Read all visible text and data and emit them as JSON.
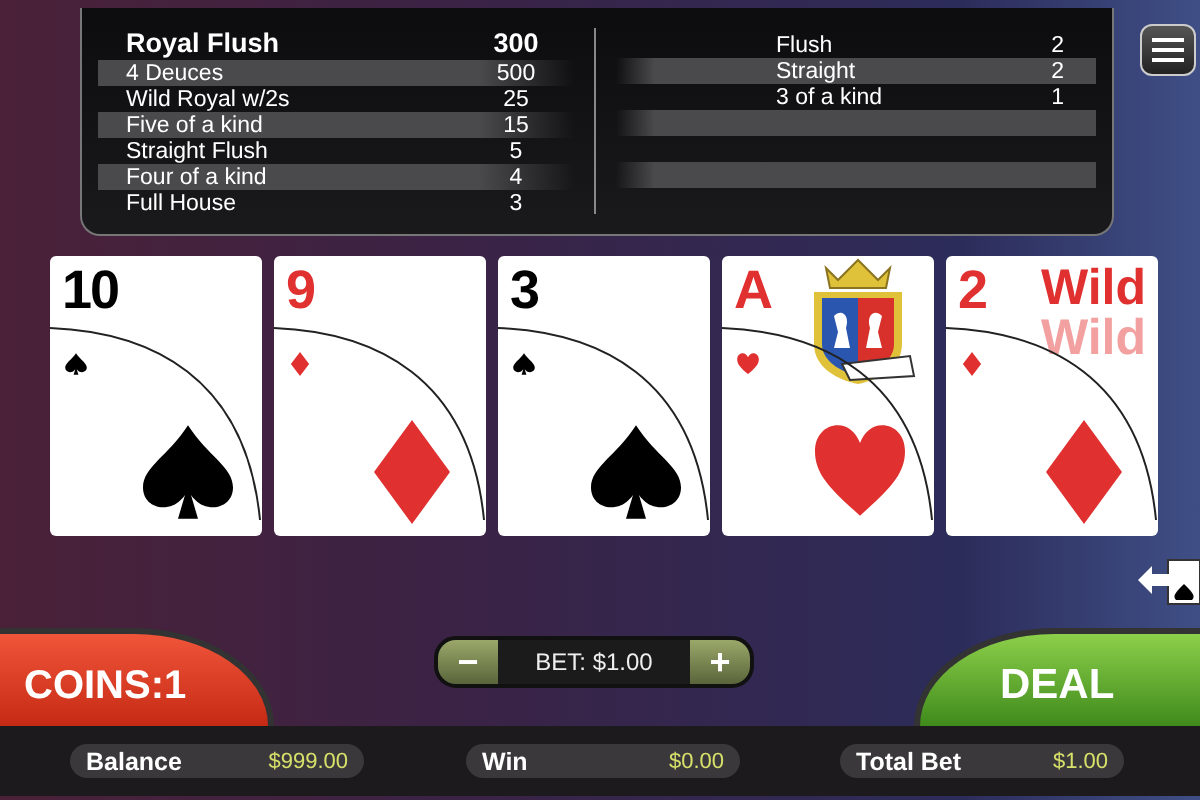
{
  "paytable": {
    "left": [
      {
        "hand": "Royal Flush",
        "payout": "300",
        "emphasized": true
      },
      {
        "hand": "4 Deuces",
        "payout": "500",
        "emphasized": false
      },
      {
        "hand": "Wild Royal w/2s",
        "payout": "25",
        "emphasized": false
      },
      {
        "hand": "Five of a kind",
        "payout": "15",
        "emphasized": false
      },
      {
        "hand": "Straight Flush",
        "payout": "5",
        "emphasized": false
      },
      {
        "hand": "Four of a kind",
        "payout": "4",
        "emphasized": false
      },
      {
        "hand": "Full House",
        "payout": "3",
        "emphasized": false
      }
    ],
    "right": [
      {
        "hand": "Flush",
        "payout": "2"
      },
      {
        "hand": "Straight",
        "payout": "2"
      },
      {
        "hand": "3 of a kind",
        "payout": "1"
      }
    ]
  },
  "cards": [
    {
      "rank": "10",
      "kind": "spade",
      "crest": false
    },
    {
      "rank": "9",
      "kind": "diamond",
      "crest": false
    },
    {
      "rank": "3",
      "kind": "spade",
      "crest": false
    },
    {
      "rank": "A",
      "kind": "heart",
      "crest": true
    },
    {
      "rank": "2",
      "kind": "diamond",
      "crest": false,
      "wild_texts": [
        "Wild",
        "Wild"
      ]
    }
  ],
  "bet": {
    "minus": "−",
    "label": "BET: $1.00",
    "plus": "+"
  },
  "coins_button": "COINS:1",
  "deal_button": "DEAL",
  "status": [
    {
      "label": "Balance",
      "value": "$999.00"
    },
    {
      "label": "Win",
      "value": "$0.00"
    },
    {
      "label": "Total Bet",
      "value": "$1.00"
    }
  ]
}
